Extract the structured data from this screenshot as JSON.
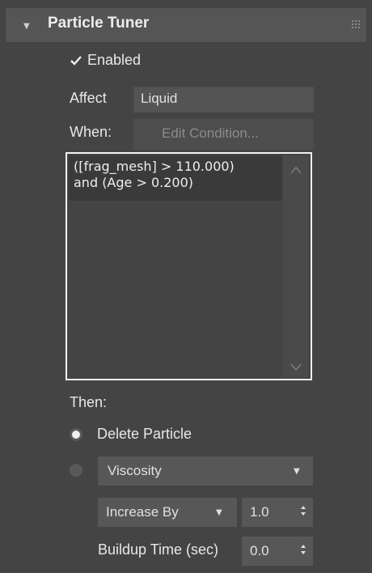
{
  "rollout": {
    "title": "Particle Tuner"
  },
  "enabled": {
    "label": "Enabled",
    "checked": true
  },
  "affect": {
    "label": "Affect",
    "value": "Liquid"
  },
  "when": {
    "label": "When:",
    "button_label": "Edit Condition..."
  },
  "condition": {
    "lines": [
      "([frag_mesh] > 110.000)",
      "and (Age > 0.200)"
    ]
  },
  "then": {
    "label": "Then:"
  },
  "delete_particle": {
    "label": "Delete Particle",
    "selected": true
  },
  "property": {
    "selected": false,
    "value": "Viscosity"
  },
  "operation": {
    "value": "Increase By"
  },
  "amount": {
    "value": "1.0"
  },
  "buildup": {
    "label": "Buildup Time (sec)",
    "value": "0.0"
  },
  "colors": {
    "panel_bg": "#444444",
    "header_bg": "#555555",
    "field_bg": "#545454",
    "highlight_border": "#f2f2f2"
  }
}
